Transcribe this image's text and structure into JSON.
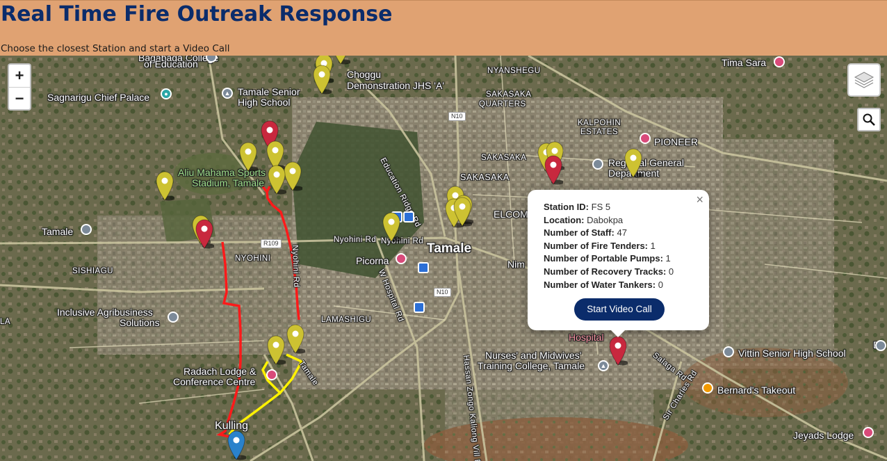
{
  "header": {
    "title": "Real Time Fire Outreak Response",
    "subtitle": "Choose the closest Station and start a Video Call",
    "background": "#e0a272",
    "title_color": "#0b2c6b"
  },
  "map": {
    "controls": {
      "zoom_in": "+",
      "zoom_out": "−",
      "layers_icon": "layers-icon",
      "search_icon": "search-icon"
    },
    "labels": {
      "bagabaga": "Bagabaga College",
      "of_education": "of Education",
      "sagnarigu_palace": "Sagnarigu Chief Palace",
      "tamale_senior": "Tamale Senior",
      "high_school": "High School",
      "choggu": "Choggu",
      "demonstration": "Demonstration JHS 'A'",
      "nyanshegu": "NYANSHEGU",
      "sakasaka_quarters_1": "SAKASAKA",
      "sakasaka_quarters_2": "QUARTERS",
      "tima_sara": "Tima Sara",
      "kalpohin_1": "KALPOHIN",
      "kalpohin_2": "ESTATES",
      "pioneer": "PIONEER",
      "aliu_1": "Aliu Mahama Sports",
      "aliu_2": "Stadium, Tamale",
      "education_ridge": "Education Ridge Rd",
      "sakasaka_a": "SAKASAKA",
      "sakasaka_b": "SAKASAKA",
      "regional_1": "Regional General",
      "regional_2": "Department",
      "tamale_left": "Tamale",
      "elcom": "ELCOM",
      "nyohini_rd_1": "Nyohini Rd",
      "nyohini_rd_2": "Nyohini Rd",
      "nyohini": "NYOHINI",
      "sishiagu": "SISHIAGU",
      "picorna": "Picorna",
      "tamale_center": "Tamale",
      "nim": "Nim",
      "inclusive_1": "Inclusive Agribusiness",
      "inclusive_2": "Solutions",
      "la": "LA",
      "lamashigu": "LAMASHIGU",
      "hospital": "Hospital",
      "nurses_1": "Nurses' and Midwives'",
      "nurses_2": "Training College, Tamale",
      "vittin": "Vittin Senior High School",
      "radach_1": "Radach Lodge &",
      "radach_2": "Conference Centre",
      "kulling": "Kulling",
      "bernards": "Bernard's Takeout",
      "jeyads": "Jeyads Lodge",
      "da": "Da",
      "r109": "R109",
      "n10_a": "N10",
      "n10_b": "N10",
      "salaga_rd": "Salaga Rd",
      "sir_charles": "Sir Charles Rd",
      "hospital_rd": "W Hospital Rd",
      "hassan": "Hassan Zongo Kaliong Vill Rd",
      "tamale_rd": "Tamale",
      "nyohini_vert": "Nyohini Rd"
    },
    "colors": {
      "station_marker": "#cdc232",
      "alert_marker": "#c8283e",
      "user_marker": "#2a82cb",
      "route_red": "#ff1a1a",
      "route_yellow": "#fff200"
    }
  },
  "popup": {
    "rows": [
      {
        "label": "Station ID:",
        "value": "FS 5"
      },
      {
        "label": "Location:",
        "value": "Dabokpa"
      },
      {
        "label": "Number of Staff:",
        "value": "47"
      },
      {
        "label": "Number of Fire Tenders:",
        "value": "1"
      },
      {
        "label": "Number of Portable Pumps:",
        "value": "1"
      },
      {
        "label": "Number of Recovery Tracks:",
        "value": "0"
      },
      {
        "label": "Number of Water Tankers:",
        "value": "0"
      }
    ],
    "close": "×",
    "button": "Start Video Call"
  }
}
